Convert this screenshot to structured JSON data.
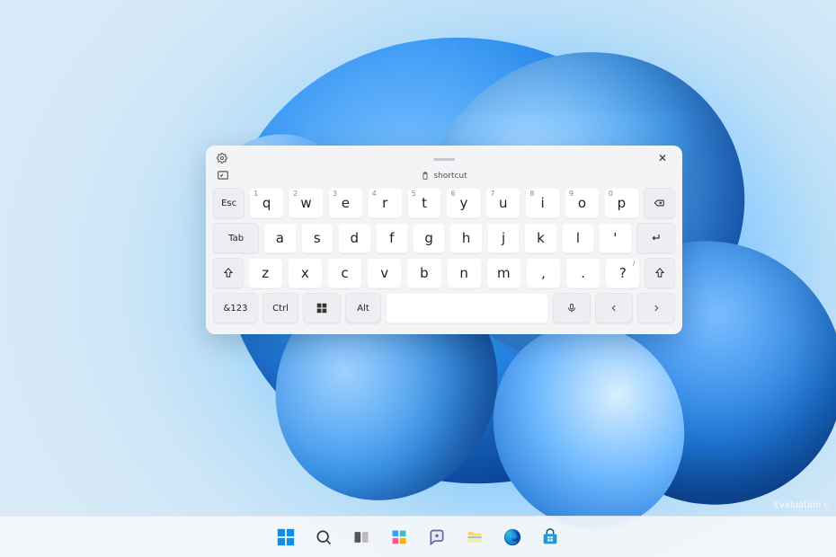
{
  "desktop": {
    "watermark": "Evaluation c"
  },
  "keyboard": {
    "suggestion": "shortcut",
    "rows": {
      "r1": {
        "esc": "Esc",
        "keys": [
          {
            "n": "1",
            "c": "q"
          },
          {
            "n": "2",
            "c": "w"
          },
          {
            "n": "3",
            "c": "e"
          },
          {
            "n": "4",
            "c": "r"
          },
          {
            "n": "5",
            "c": "t"
          },
          {
            "n": "6",
            "c": "y"
          },
          {
            "n": "7",
            "c": "u"
          },
          {
            "n": "8",
            "c": "i"
          },
          {
            "n": "9",
            "c": "o"
          },
          {
            "n": "0",
            "c": "p"
          }
        ]
      },
      "r2": {
        "tab": "Tab",
        "keys": [
          "a",
          "s",
          "d",
          "f",
          "g",
          "h",
          "j",
          "k",
          "l"
        ],
        "apos": "'"
      },
      "r3": {
        "keys": [
          "z",
          "x",
          "c",
          "v",
          "b",
          "n",
          "m"
        ],
        "comma": ",",
        "period": ".",
        "qmark_main": "?",
        "qmark_sup": "/"
      },
      "r4": {
        "numsym": "&123",
        "ctrl": "Ctrl",
        "alt": "Alt"
      }
    }
  },
  "taskbar": {
    "items": [
      {
        "name": "start"
      },
      {
        "name": "search"
      },
      {
        "name": "task-view"
      },
      {
        "name": "widgets"
      },
      {
        "name": "chat"
      },
      {
        "name": "file-explorer"
      },
      {
        "name": "edge"
      },
      {
        "name": "store"
      }
    ]
  }
}
